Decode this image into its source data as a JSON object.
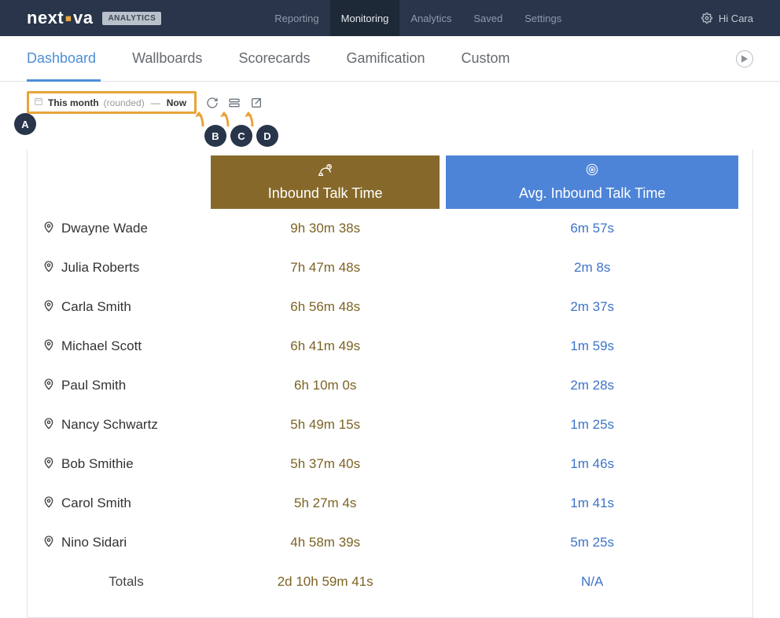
{
  "branding": {
    "word_pre": "next",
    "word_post": "va",
    "badge": "ANALYTICS"
  },
  "topnav": {
    "items": [
      {
        "label": "Reporting",
        "active": false
      },
      {
        "label": "Monitoring",
        "active": true
      },
      {
        "label": "Analytics",
        "active": false
      },
      {
        "label": "Saved",
        "active": false
      },
      {
        "label": "Settings",
        "active": false
      }
    ],
    "user_greeting": "Hi Cara"
  },
  "subtabs": {
    "items": [
      {
        "label": "Dashboard",
        "active": true
      },
      {
        "label": "Wallboards",
        "active": false
      },
      {
        "label": "Scorecards",
        "active": false
      },
      {
        "label": "Gamification",
        "active": false
      },
      {
        "label": "Custom",
        "active": false
      }
    ]
  },
  "toolbar": {
    "range_primary": "This month",
    "range_modifier": "(rounded)",
    "range_secondary": "Now"
  },
  "callouts": {
    "A": "A",
    "B": "B",
    "C": "C",
    "D": "D"
  },
  "table": {
    "columns": {
      "inbound": "Inbound Talk Time",
      "avg": "Avg. Inbound Talk Time"
    },
    "rows": [
      {
        "name": "Dwayne Wade",
        "inbound": "9h 30m 38s",
        "avg": "6m 57s"
      },
      {
        "name": "Julia Roberts",
        "inbound": "7h 47m 48s",
        "avg": "2m 8s"
      },
      {
        "name": "Carla Smith",
        "inbound": "6h 56m 48s",
        "avg": "2m 37s"
      },
      {
        "name": "Michael Scott",
        "inbound": "6h 41m 49s",
        "avg": "1m 59s"
      },
      {
        "name": "Paul Smith",
        "inbound": "6h 10m 0s",
        "avg": "2m 28s"
      },
      {
        "name": "Nancy Schwartz",
        "inbound": "5h 49m 15s",
        "avg": "1m 25s"
      },
      {
        "name": "Bob Smithie",
        "inbound": "5h 37m 40s",
        "avg": "1m 46s"
      },
      {
        "name": "Carol Smith",
        "inbound": "5h 27m 4s",
        "avg": "1m 41s"
      },
      {
        "name": "Nino Sidari",
        "inbound": "4h 58m 39s",
        "avg": "5m 25s"
      }
    ],
    "totals": {
      "label": "Totals",
      "inbound": "2d 10h 59m 41s",
      "avg": "N/A"
    }
  }
}
